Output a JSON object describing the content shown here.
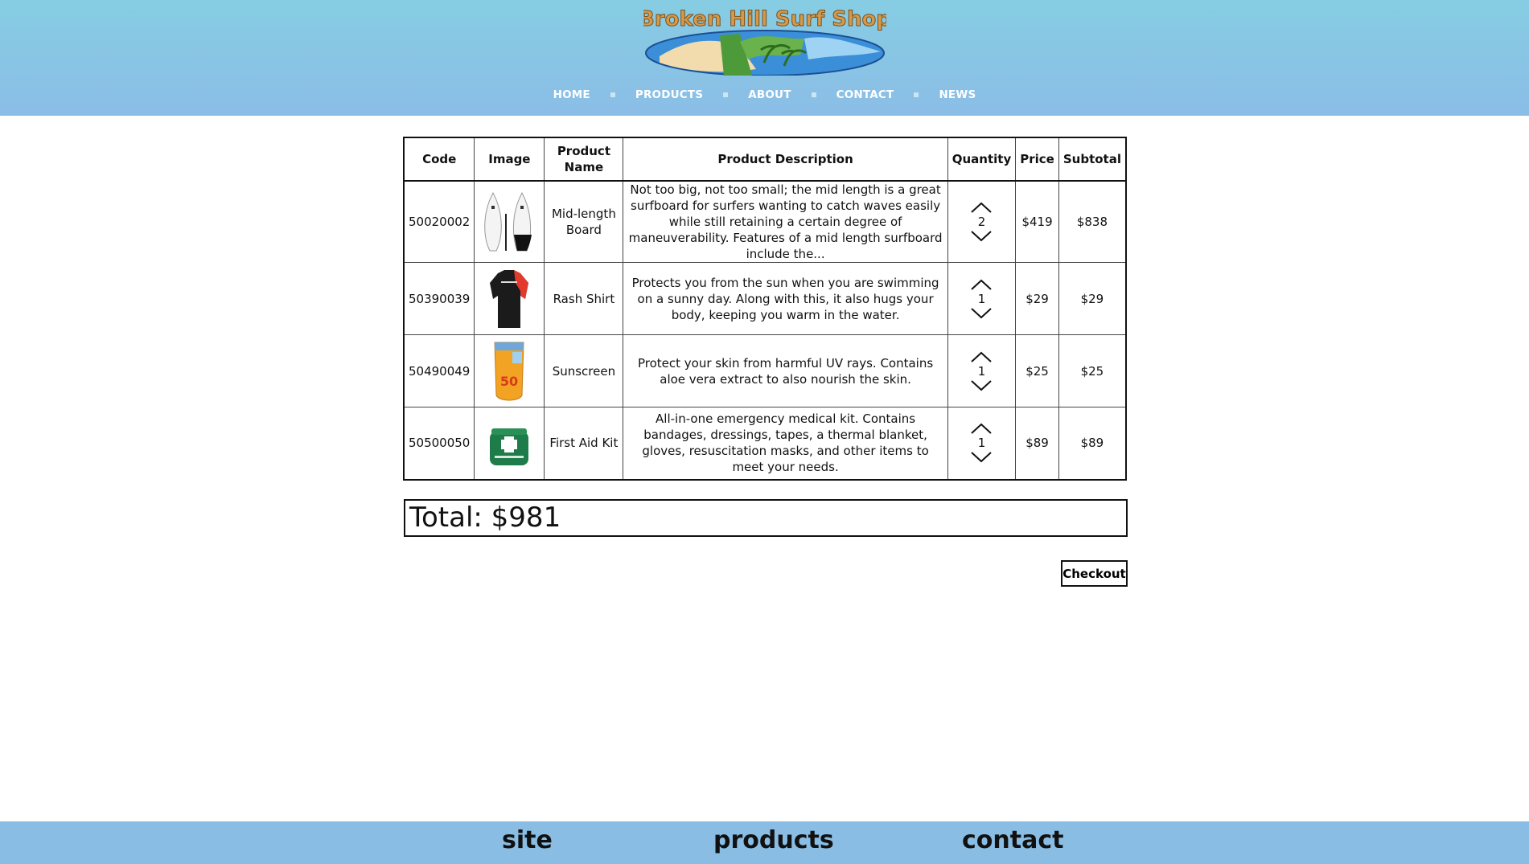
{
  "logo": {
    "text": "Broken Hill Surf Shop"
  },
  "nav": {
    "items": [
      "HOME",
      "PRODUCTS",
      "ABOUT",
      "CONTACT",
      "NEWS"
    ]
  },
  "table": {
    "headers": {
      "code": "Code",
      "image": "Image",
      "name": "Product Name",
      "description": "Product Description",
      "quantity": "Quantity",
      "price": "Price",
      "subtotal": "Subtotal"
    },
    "rows": [
      {
        "code": "50020002",
        "image_icon": "surfboard-image",
        "name": "Mid-length Board",
        "description": "Not too big, not too small; the mid length is a great surfboard for surfers wanting to catch waves easily while still retaining a certain degree of maneuverability. Features of a mid length surfboard include the...",
        "quantity": "2",
        "price": "$419",
        "subtotal": "$838"
      },
      {
        "code": "50390039",
        "image_icon": "rash-shirt-image",
        "name": "Rash Shirt",
        "description": "Protects you from the sun when you are swimming on a sunny day. Along with this, it also hugs your body, keeping you warm in the water.",
        "quantity": "1",
        "price": "$29",
        "subtotal": "$29"
      },
      {
        "code": "50490049",
        "image_icon": "sunscreen-image",
        "name": "Sunscreen",
        "description": "Protect your skin from harmful UV rays. Contains aloe vera extract to also nourish the skin.",
        "quantity": "1",
        "price": "$25",
        "subtotal": "$25"
      },
      {
        "code": "50500050",
        "image_icon": "first-aid-kit-image",
        "name": "First Aid Kit",
        "description": "All-in-one emergency medical kit. Contains bandages, dressings, tapes, a thermal blanket, gloves, resuscitation masks, and other items to meet your needs.",
        "quantity": "1",
        "price": "$89",
        "subtotal": "$89"
      }
    ]
  },
  "total": {
    "label": "Total: $981"
  },
  "checkout": {
    "label": "Checkout"
  },
  "footer": {
    "links": [
      "site",
      "products",
      "contact"
    ]
  },
  "colors": {
    "header_top": "#86cde3",
    "header_bottom": "#8bbde6",
    "footer": "#89bde3"
  }
}
